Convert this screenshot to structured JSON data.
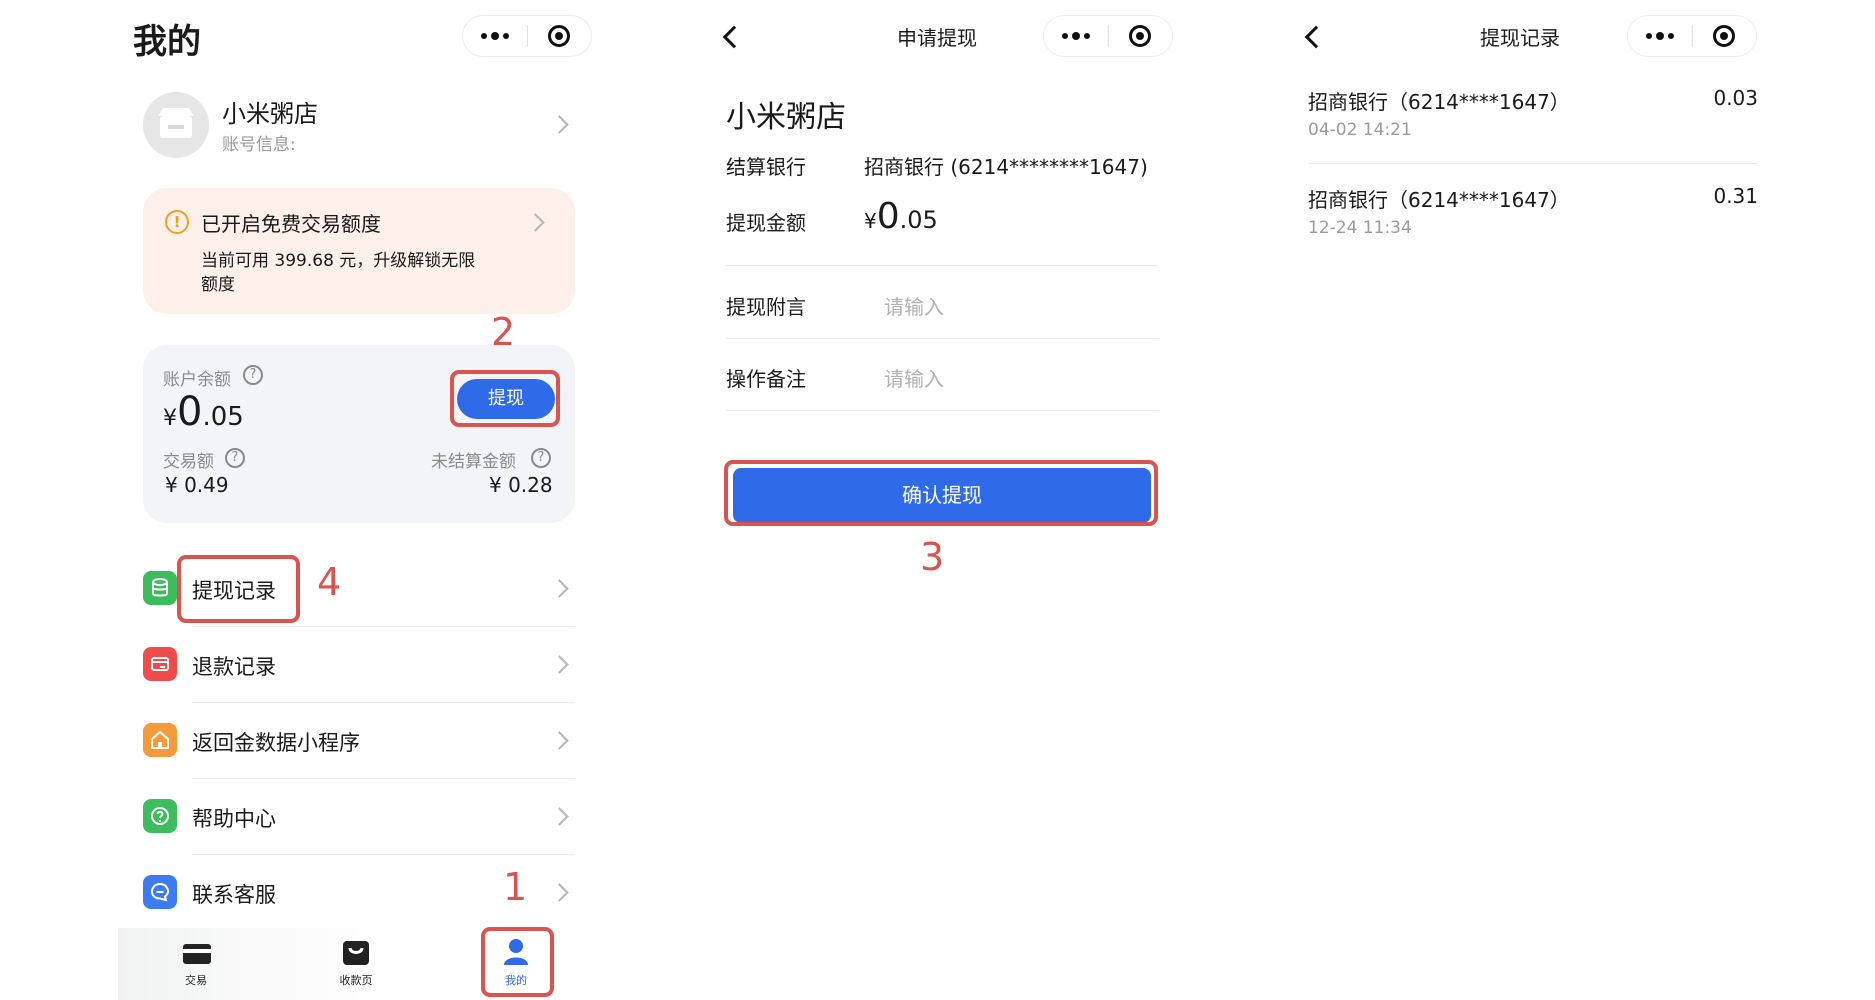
{
  "left": {
    "page_title": "我的",
    "profile": {
      "name": "小米粥店",
      "account_info": "账号信息:"
    },
    "notice": {
      "title": "已开启免费交易额度",
      "line1": "当前可用 399.68 元，升级解锁无限",
      "line2": "额度"
    },
    "balance": {
      "label": "账户余额",
      "currency": "¥",
      "amount_int": "0",
      "amount_dec": ".05",
      "withdraw_label": "提现",
      "trade_label": "交易额",
      "trade_value": "¥ 0.49",
      "unsettled_label": "未结算金额",
      "unsettled_value": "¥ 0.28"
    },
    "menu": [
      {
        "label": "提现记录",
        "icon": "database-icon",
        "color": "#3cbc5c"
      },
      {
        "label": "退款记录",
        "icon": "card-refund-icon",
        "color": "#ef4b4b"
      },
      {
        "label": "返回金数据小程序",
        "icon": "home-icon",
        "color": "#f59a3a"
      },
      {
        "label": "帮助中心",
        "icon": "help-icon",
        "color": "#3cbc5c"
      },
      {
        "label": "联系客服",
        "icon": "chat-icon",
        "color": "#3d7cf0"
      }
    ],
    "tabbar": [
      {
        "label": "交易",
        "icon": "card-icon"
      },
      {
        "label": "收款页",
        "icon": "bag-icon"
      },
      {
        "label": "我的",
        "icon": "user-icon"
      }
    ]
  },
  "middle": {
    "nav_title": "申请提现",
    "shop_name": "小米粥店",
    "bank_label": "结算银行",
    "bank_value": "招商银行 (6214********1647)",
    "amount_label": "提现金额",
    "amount_currency": "¥",
    "amount_int": "0",
    "amount_dec": ".05",
    "note_label": "提现附言",
    "note_placeholder": "请输入",
    "remark_label": "操作备注",
    "remark_placeholder": "请输入",
    "confirm_label": "确认提现"
  },
  "right": {
    "nav_title": "提现记录",
    "records": [
      {
        "bank": "招商银行（6214****1647）",
        "amount": "0.03",
        "time": "04-02 14:21"
      },
      {
        "bank": "招商银行（6214****1647）",
        "amount": "0.31",
        "time": "12-24 11:34"
      }
    ]
  },
  "steps": [
    "1",
    "2",
    "3",
    "4"
  ],
  "colors": {
    "primary": "#2f6be8",
    "annotation": "#d9534f",
    "notice_bg": "#fdf0ea",
    "card_bg": "#f3f4f7"
  }
}
